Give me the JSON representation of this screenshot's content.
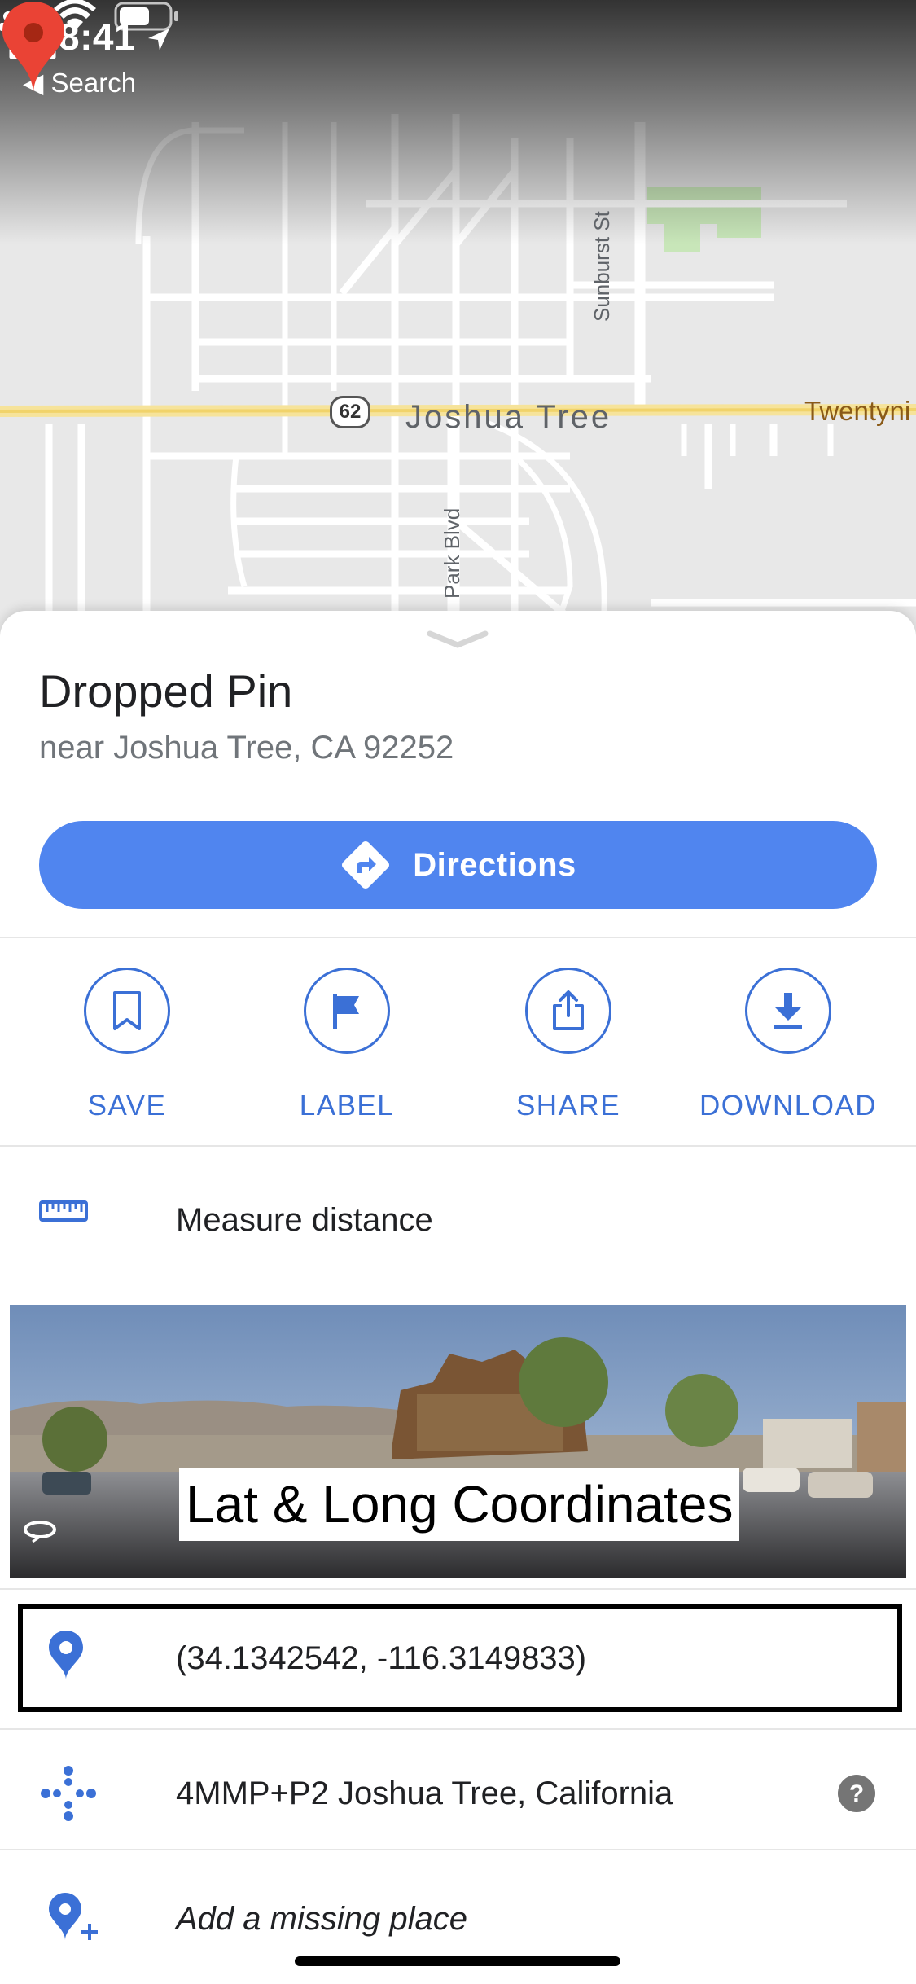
{
  "status_bar": {
    "time": "8:41",
    "back_label": "◀ Search"
  },
  "map": {
    "town_label": "Joshua Tree",
    "highway_shield": "62",
    "road_east_label": "Twentyni",
    "road_sunburst": "Sunburst St",
    "road_park": "Park Blvd"
  },
  "place": {
    "title": "Dropped Pin",
    "subtitle": "near Joshua Tree, CA 92252"
  },
  "directions_label": "Directions",
  "actions": [
    {
      "label": "SAVE",
      "icon": "bookmark-icon"
    },
    {
      "label": "LABEL",
      "icon": "flag-icon"
    },
    {
      "label": "SHARE",
      "icon": "share-icon"
    },
    {
      "label": "DOWNLOAD",
      "icon": "download-icon"
    }
  ],
  "measure_label": "Measure distance",
  "street_view_caption": "Lat & Long Coordinates",
  "coordinates": "(34.1342542, -116.3149833)",
  "plus_code": "4MMP+P2 Joshua Tree, California",
  "add_place_label": "Add a missing place",
  "colors": {
    "accent": "#5085ef",
    "action_blue": "#3b70d6",
    "pin_red": "#ea4335"
  }
}
